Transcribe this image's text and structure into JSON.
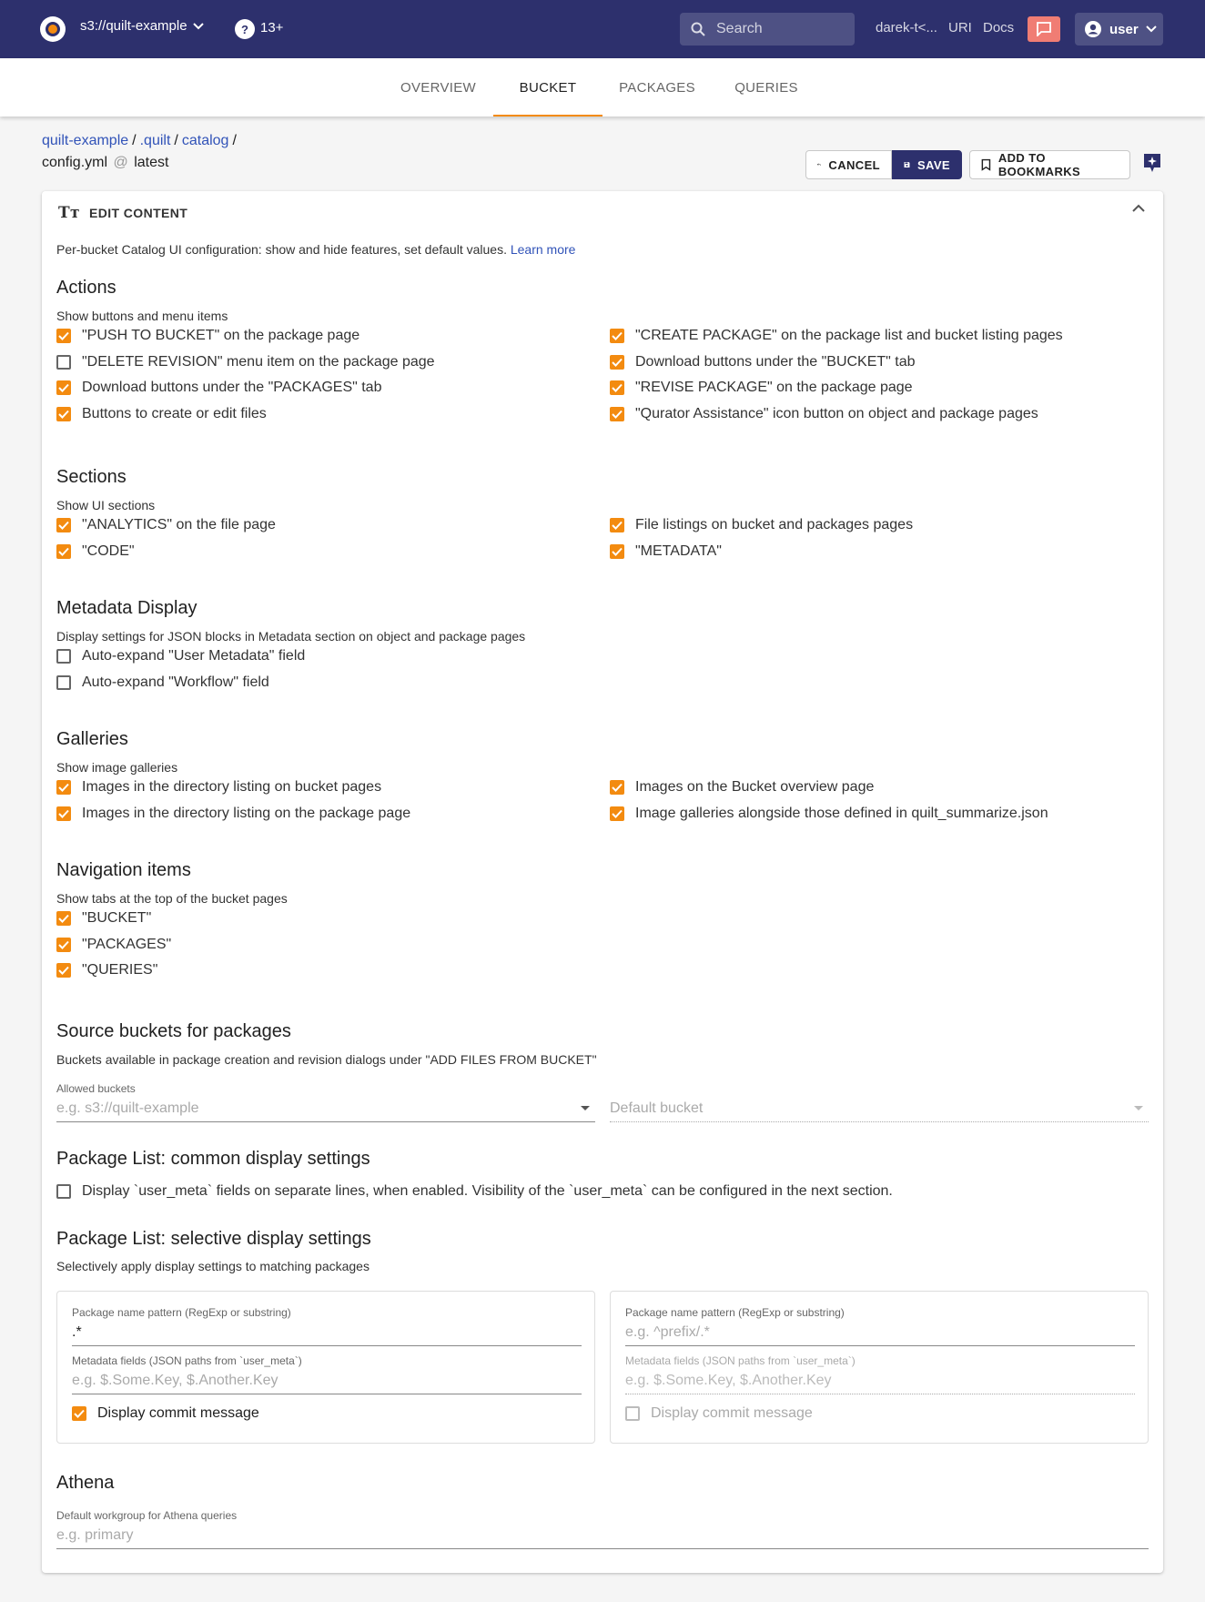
{
  "topbar": {
    "bucket": "s3://quilt-example",
    "help_icon": "question-icon",
    "help_count": "13+",
    "search_placeholder": "Search",
    "links": [
      "darek-t<...",
      "URI",
      "Docs"
    ],
    "user_label": "user"
  },
  "tabs": [
    "OVERVIEW",
    "BUCKET",
    "PACKAGES",
    "QUERIES"
  ],
  "active_tab": "BUCKET",
  "breadcrumb": {
    "parts": [
      "quilt-example",
      ".quilt",
      "catalog"
    ],
    "file": "config.yml",
    "at": "@",
    "version": "latest"
  },
  "buttons": {
    "cancel": "CANCEL",
    "save": "SAVE",
    "bookmark": "ADD TO BOOKMARKS"
  },
  "card": {
    "header": "EDIT CONTENT",
    "intro": "Per-bucket Catalog UI configuration: show and hide features, set default values.",
    "learn_more": "Learn more"
  },
  "actions": {
    "title": "Actions",
    "subtitle": "Show buttons and menu items",
    "left": [
      {
        "label": "\"PUSH TO BUCKET\" on the package page",
        "checked": true
      },
      {
        "label": "\"DELETE REVISION\" menu item on the package page",
        "checked": false
      },
      {
        "label": "Download buttons under the \"PACKAGES\" tab",
        "checked": true
      },
      {
        "label": "Buttons to create or edit files",
        "checked": true
      }
    ],
    "right": [
      {
        "label": "\"CREATE PACKAGE\" on the package list and bucket listing pages",
        "checked": true
      },
      {
        "label": "Download buttons under the \"BUCKET\" tab",
        "checked": true
      },
      {
        "label": "\"REVISE PACKAGE\" on the package page",
        "checked": true
      },
      {
        "label": "\"Qurator Assistance\" icon button on object and package pages",
        "checked": true
      }
    ]
  },
  "sections": {
    "title": "Sections",
    "subtitle": "Show UI sections",
    "left": [
      {
        "label": "\"ANALYTICS\" on the file page",
        "checked": true
      },
      {
        "label": "\"CODE\"",
        "checked": true
      }
    ],
    "right": [
      {
        "label": "File listings on bucket and packages pages",
        "checked": true
      },
      {
        "label": "\"METADATA\"",
        "checked": true
      }
    ]
  },
  "metadata_display": {
    "title": "Metadata Display",
    "subtitle": "Display settings for JSON blocks in Metadata section on object and package pages",
    "left": [
      {
        "label": "Auto-expand \"User Metadata\" field",
        "checked": false
      },
      {
        "label": "Auto-expand \"Workflow\" field",
        "checked": false
      }
    ]
  },
  "galleries": {
    "title": "Galleries",
    "subtitle": "Show image galleries",
    "left": [
      {
        "label": "Images in the directory listing on bucket pages",
        "checked": true
      },
      {
        "label": "Images in the directory listing on the package page",
        "checked": true
      }
    ],
    "right": [
      {
        "label": "Images on the Bucket overview page",
        "checked": true
      },
      {
        "label": "Image galleries alongside those defined in quilt_summarize.json",
        "checked": true
      }
    ]
  },
  "navigation": {
    "title": "Navigation items",
    "subtitle": "Show tabs at the top of the bucket pages",
    "left": [
      {
        "label": "\"BUCKET\"",
        "checked": true
      },
      {
        "label": "\"PACKAGES\"",
        "checked": true
      },
      {
        "label": "\"QUERIES\"",
        "checked": true
      }
    ]
  },
  "source_buckets": {
    "title": "Source buckets for packages",
    "subtitle": "Buckets available in package creation and revision dialogs under \"ADD FILES FROM BUCKET\"",
    "allowed_label": "Allowed buckets",
    "allowed_placeholder": "e.g. s3://quilt-example",
    "default_placeholder": "Default bucket"
  },
  "package_list_common": {
    "title": "Package List: common display settings",
    "checkbox": {
      "label": "Display `user_meta` fields on separate lines, when enabled. Visibility of the `user_meta` can be configured in the next section.",
      "checked": false
    }
  },
  "package_list_selective": {
    "title": "Package List: selective display settings",
    "subtitle": "Selectively apply display settings to matching packages",
    "boxes": [
      {
        "pattern_label": "Package name pattern (RegExp or substring)",
        "pattern_value": ".*",
        "meta_label": "Metadata fields (JSON paths from `user_meta`)",
        "meta_placeholder": "e.g. $.Some.Key, $.Another.Key",
        "commit_label": "Display commit message",
        "commit_checked": true
      },
      {
        "pattern_label": "Package name pattern (RegExp or substring)",
        "pattern_placeholder": "e.g. ^prefix/.*",
        "meta_label": "Metadata fields (JSON paths from `user_meta`)",
        "meta_placeholder": "e.g. $.Some.Key, $.Another.Key",
        "commit_label": "Display commit message",
        "commit_checked": false
      }
    ]
  },
  "athena": {
    "title": "Athena",
    "workgroup_label": "Default workgroup for Athena queries",
    "workgroup_placeholder": "e.g. primary"
  },
  "colors": {
    "topbar": "#2d306d",
    "accent": "#f38b10",
    "link": "#3153b8",
    "chat": "#f07d74"
  }
}
